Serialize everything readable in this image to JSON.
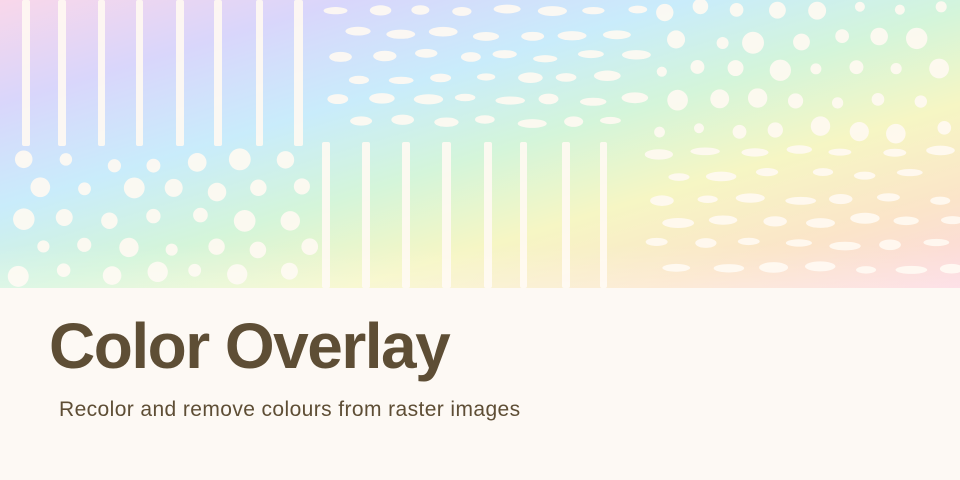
{
  "banner": {
    "title": "Color Overlay",
    "subtitle": "Recolor and remove colours from raster images"
  },
  "colors": {
    "background": "#fdf9f4",
    "text": "#5e4e35",
    "pattern": "#fffaf2",
    "gradient": [
      "#f9d7ea",
      "#d9d6fb",
      "#c9ecfb",
      "#d4f5da",
      "#f6f6c4",
      "#fbe5c9",
      "#fcd7e0"
    ]
  }
}
